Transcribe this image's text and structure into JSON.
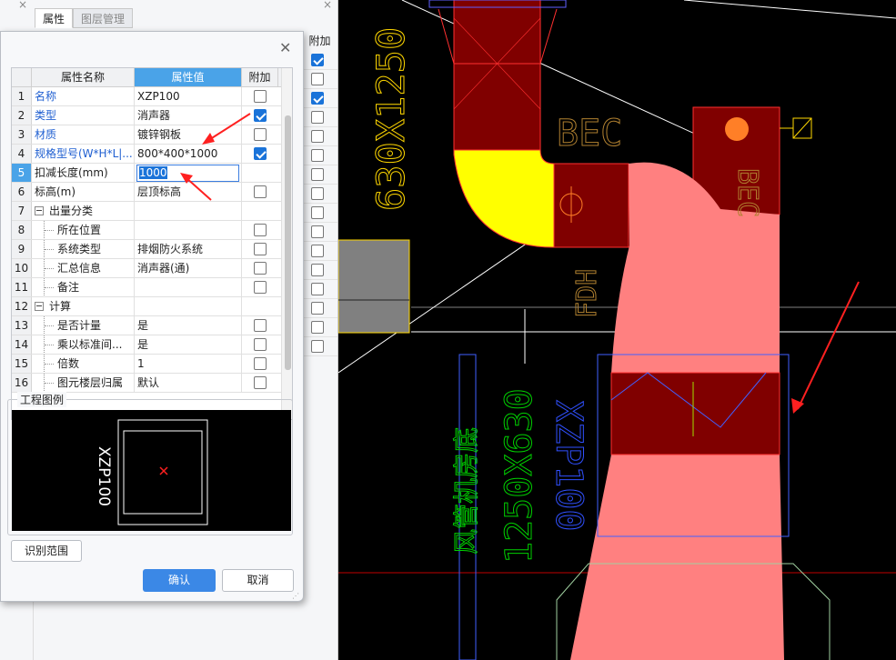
{
  "panel": {
    "tabs": [
      "属性",
      "图层管理"
    ],
    "add_column": "附加",
    "close_glyph": "×",
    "checks": [
      true,
      false,
      true,
      false,
      false,
      false,
      false,
      false,
      false,
      false,
      false,
      false,
      false,
      false,
      false,
      false
    ]
  },
  "dialog": {
    "close_glyph": "✕",
    "headers": {
      "num": "",
      "name": "属性名称",
      "value": "属性值",
      "add": "附加"
    },
    "rows": [
      {
        "num": "1",
        "name": "名称",
        "value": "XZP100",
        "blue": true,
        "check": false
      },
      {
        "num": "2",
        "name": "类型",
        "value": "消声器",
        "blue": true,
        "check": true
      },
      {
        "num": "3",
        "name": "材质",
        "value": "镀锌钢板",
        "blue": true,
        "check": false
      },
      {
        "num": "4",
        "name": "规格型号(W*H*L|...",
        "value": "800*400*1000",
        "blue": true,
        "check": true
      },
      {
        "num": "5",
        "name": "扣减长度(mm)",
        "value": "1000",
        "editing": true,
        "check": null
      },
      {
        "num": "6",
        "name": "标高(m)",
        "value": "层顶标高",
        "check": false
      },
      {
        "num": "7",
        "name": "出量分类",
        "value": "",
        "group": true,
        "check": null
      },
      {
        "num": "8",
        "name": "所在位置",
        "value": "",
        "child": true,
        "check": false
      },
      {
        "num": "9",
        "name": "系统类型",
        "value": "排烟防火系统",
        "child": true,
        "check": false
      },
      {
        "num": "10",
        "name": "汇总信息",
        "value": "消声器(通)",
        "child": true,
        "check": false
      },
      {
        "num": "11",
        "name": "备注",
        "value": "",
        "child": true,
        "check": false
      },
      {
        "num": "12",
        "name": "计算",
        "value": "",
        "group": true,
        "check": null
      },
      {
        "num": "13",
        "name": "是否计量",
        "value": "是",
        "child": true,
        "check": false
      },
      {
        "num": "14",
        "name": "乘以标准间...",
        "value": "是",
        "child": true,
        "check": false
      },
      {
        "num": "15",
        "name": "倍数",
        "value": "1",
        "child": true,
        "check": false
      },
      {
        "num": "16",
        "name": "图元楼层归属",
        "value": "默认",
        "child": true,
        "check": false
      }
    ],
    "legend_title": "工程图例",
    "legend_label": "XZP100",
    "btn_range": "识别范围",
    "btn_ok": "确认",
    "btn_cancel": "取消"
  },
  "cad": {
    "labels": {
      "duct_top": "630X1250",
      "bec1": "BEC",
      "bec2": "BEC",
      "fdh": "FDH",
      "duct_low": "1250X630",
      "xzp": "XZP100",
      "green": "风管机房底"
    },
    "colors": {
      "darkred": "#800000",
      "yellow": "#ffff00",
      "pink": "#ff8080",
      "orange": "#ff7f27",
      "green": "#00c000",
      "blue": "#3050ff"
    }
  }
}
